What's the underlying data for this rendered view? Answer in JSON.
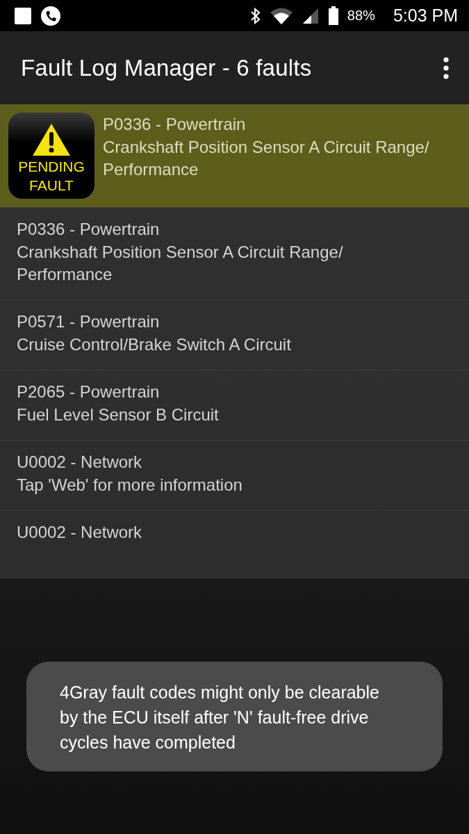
{
  "status_bar": {
    "battery": "88%",
    "time": "5:03 PM"
  },
  "app_bar": {
    "title": "Fault Log Manager - 6 faults"
  },
  "faults": [
    {
      "kind": "pending",
      "selected": true,
      "badge": [
        "PENDING",
        "FAULT"
      ],
      "code": "P0336 - Powertrain",
      "description": "Crankshaft Position Sensor A Circuit Range/ Performance"
    },
    {
      "kind": "plain",
      "selected": false,
      "code": "P0336 - Powertrain",
      "description": "Crankshaft Position Sensor A Circuit Range/ Performance"
    },
    {
      "kind": "plain",
      "selected": false,
      "code": "P0571 - Powertrain",
      "description": "Cruise Control/Brake Switch A Circuit"
    },
    {
      "kind": "plain",
      "selected": false,
      "code": "P2065 - Powertrain",
      "description": "Fuel Level Sensor B Circuit"
    },
    {
      "kind": "plain",
      "selected": false,
      "code": "U0002 - Network",
      "description": "Tap 'Web' for more information"
    },
    {
      "kind": "plain",
      "selected": false,
      "code": "U0002 - Network"
    }
  ],
  "toast": {
    "message": "4Gray fault codes might only be clearable by the ECU itself after 'N' fault-free drive cycles have completed"
  }
}
